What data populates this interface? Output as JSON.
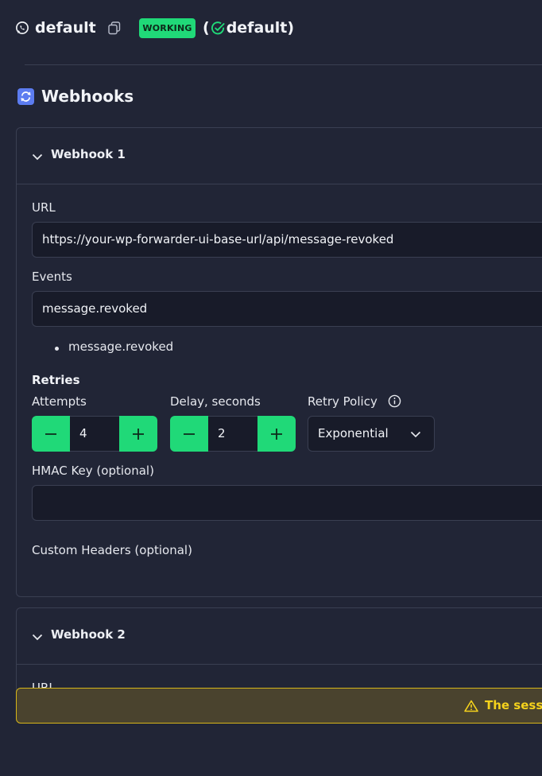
{
  "header": {
    "session_name": "default",
    "status": "WORKING",
    "engine_prefix": "(",
    "engine_name": "default",
    "engine_suffix": ")"
  },
  "section": {
    "title": "Webhooks"
  },
  "webhooks": [
    {
      "title": "Webhook 1",
      "url_label": "URL",
      "url_value": "https://your-wp-forwarder-ui-base-url/api/message-revoked",
      "events_label": "Events",
      "events_value": "message.revoked",
      "events_list": [
        "message.revoked"
      ],
      "retries_label": "Retries",
      "attempts_label": "Attempts",
      "attempts_value": "4",
      "delay_label": "Delay, seconds",
      "delay_value": "2",
      "policy_label": "Retry Policy",
      "policy_value": "Exponential",
      "hmac_label": "HMAC Key (optional)",
      "hmac_value": "",
      "headers_label": "Custom Headers (optional)"
    },
    {
      "title": "Webhook 2",
      "url_label": "URL"
    }
  ],
  "banner": {
    "message": "The session"
  },
  "colors": {
    "accent": "#20d978",
    "background": "#212536",
    "warning": "#f5d21c"
  }
}
